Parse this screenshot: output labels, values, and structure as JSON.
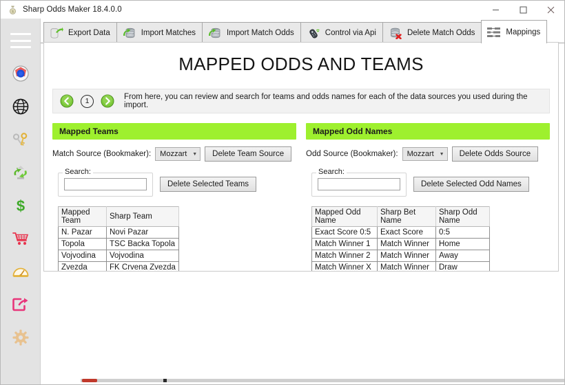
{
  "window": {
    "title": "Sharp Odds Maker 18.4.0.0",
    "app_icon": "money-bag-icon",
    "controls": {
      "minimize": "minimize-icon",
      "maximize": "maximize-icon",
      "close": "close-icon"
    }
  },
  "sidebar": {
    "items": [
      {
        "icon": "hamburger-menu-icon",
        "label": "Menu"
      },
      {
        "icon": "soccer-ball-icon",
        "label": "Matches"
      },
      {
        "icon": "globe-icon",
        "label": "Web"
      },
      {
        "icon": "keys-icon",
        "label": "Credentials"
      },
      {
        "icon": "recycle-refresh-icon",
        "label": "Refresh"
      },
      {
        "icon": "dollar-sign-icon",
        "label": "Money"
      },
      {
        "icon": "shopping-cart-icon",
        "label": "Cart"
      },
      {
        "icon": "gauge-icon",
        "label": "Performance"
      },
      {
        "icon": "export-share-icon",
        "label": "Export"
      },
      {
        "icon": "gear-icon",
        "label": "Settings"
      }
    ]
  },
  "tabs": [
    {
      "label": "Export Data",
      "icon": "export-data-icon",
      "active": false
    },
    {
      "label": "Import Matches",
      "icon": "database-import-icon",
      "active": false
    },
    {
      "label": "Import Match Odds",
      "icon": "database-import-icon",
      "active": false
    },
    {
      "label": "Control via Api",
      "icon": "remote-control-icon",
      "active": false
    },
    {
      "label": "Delete Match Odds",
      "icon": "database-delete-icon",
      "active": false
    },
    {
      "label": "Mappings",
      "icon": "mappings-icon",
      "active": true
    }
  ],
  "page": {
    "title": "MAPPED ODDS AND TEAMS",
    "info": {
      "back_icon": "green-back-arrow-icon",
      "step": "1",
      "forward_icon": "green-forward-arrow-icon",
      "text": "From here, you can review and search for teams and odds names for each of the data sources you used during the import."
    }
  },
  "colors": {
    "header_green": "#9ef02e",
    "rail_bg": "#e3e3e3",
    "accent_red": "#c0392b"
  },
  "teams_panel": {
    "header": "Mapped Teams",
    "source_label": "Match Source (Bookmaker):",
    "source_value": "Mozzart",
    "delete_source_button": "Delete Team Source",
    "search_group_title": "Search:",
    "search_value": "",
    "search_placeholder": "",
    "delete_selected_button": "Delete Selected Teams",
    "table": {
      "columns": [
        "Mapped Team",
        "Sharp Team"
      ],
      "rows": [
        [
          "N. Pazar",
          "Novi Pazar"
        ],
        [
          "Topola",
          "TSC Backa Topola"
        ],
        [
          "Vojvodina",
          "Vojvodina"
        ],
        [
          "Zvezda",
          "FK Crvena Zvezda"
        ]
      ]
    }
  },
  "odds_panel": {
    "header": "Mapped Odd Names",
    "source_label": "Odd Source (Bookmaker):",
    "source_value": "Mozzart",
    "delete_source_button": "Delete Odds Source",
    "search_group_title": "Search:",
    "search_value": "",
    "search_placeholder": "",
    "delete_selected_button": "Delete Selected Odd Names",
    "table": {
      "columns": [
        "Mapped Odd Name",
        "Sharp Bet Name",
        "Sharp Odd Name"
      ],
      "rows": [
        [
          "Exact Score 0:5",
          "Exact Score",
          "0:5"
        ],
        [
          "Match Winner 1",
          "Match Winner",
          "Home"
        ],
        [
          "Match Winner 2",
          "Match Winner",
          "Away"
        ],
        [
          "Match Winner X",
          "Match Winner",
          "Draw"
        ]
      ]
    }
  }
}
